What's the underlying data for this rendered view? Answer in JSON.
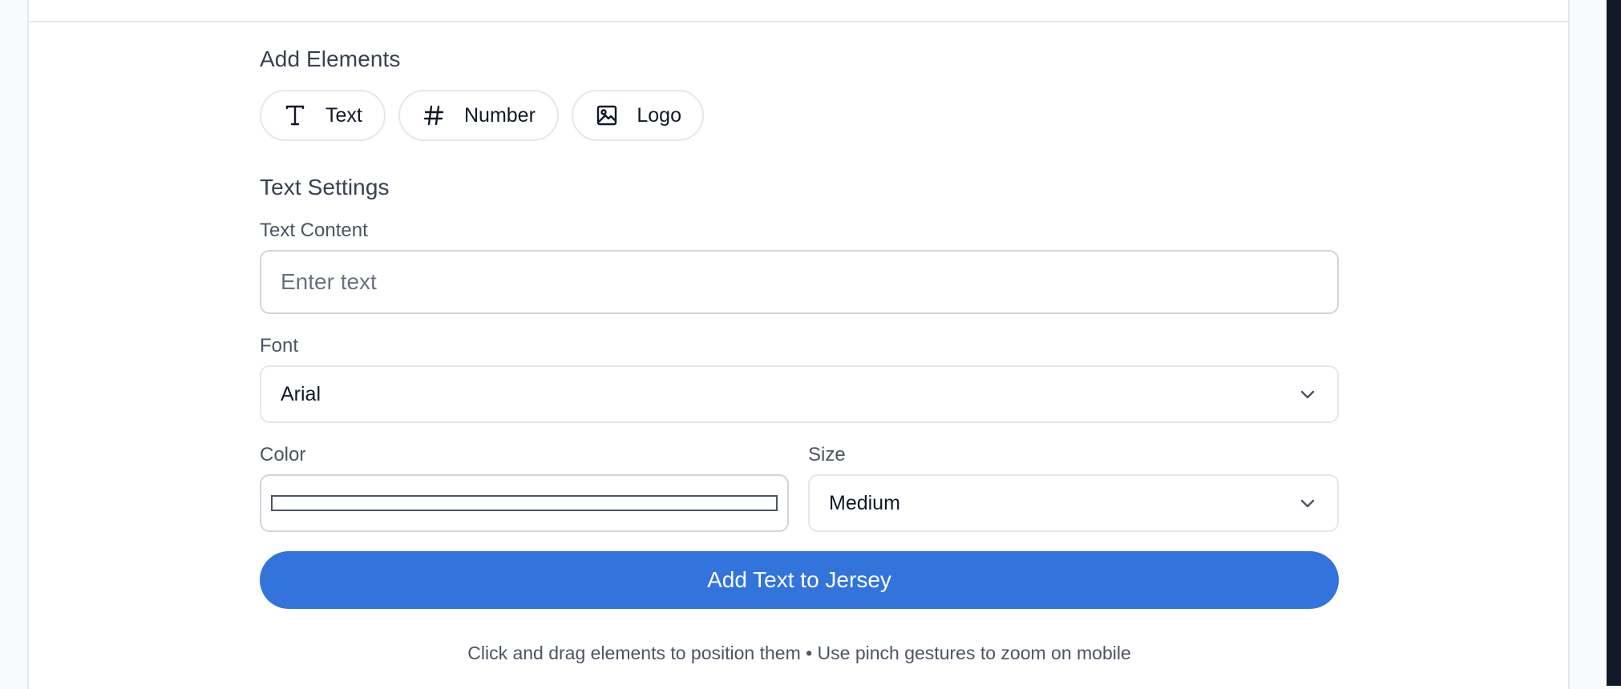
{
  "add_elements": {
    "heading": "Add Elements",
    "buttons": [
      {
        "label": "Text",
        "icon": "text-type-icon"
      },
      {
        "label": "Number",
        "icon": "hash-icon"
      },
      {
        "label": "Logo",
        "icon": "image-icon"
      }
    ]
  },
  "text_settings": {
    "heading": "Text Settings",
    "content_label": "Text Content",
    "content_placeholder": "Enter text",
    "content_value": "",
    "font_label": "Font",
    "font_value": "Arial",
    "color_label": "Color",
    "color_value": "#ffffff",
    "size_label": "Size",
    "size_value": "Medium"
  },
  "action": {
    "add_button_label": "Add Text to Jersey"
  },
  "hint": "Click and drag elements to position them • Use pinch gestures to zoom on mobile",
  "colors": {
    "primary": "#3273dc",
    "border": "#e5e7eb",
    "dark_strip": "#111827"
  }
}
